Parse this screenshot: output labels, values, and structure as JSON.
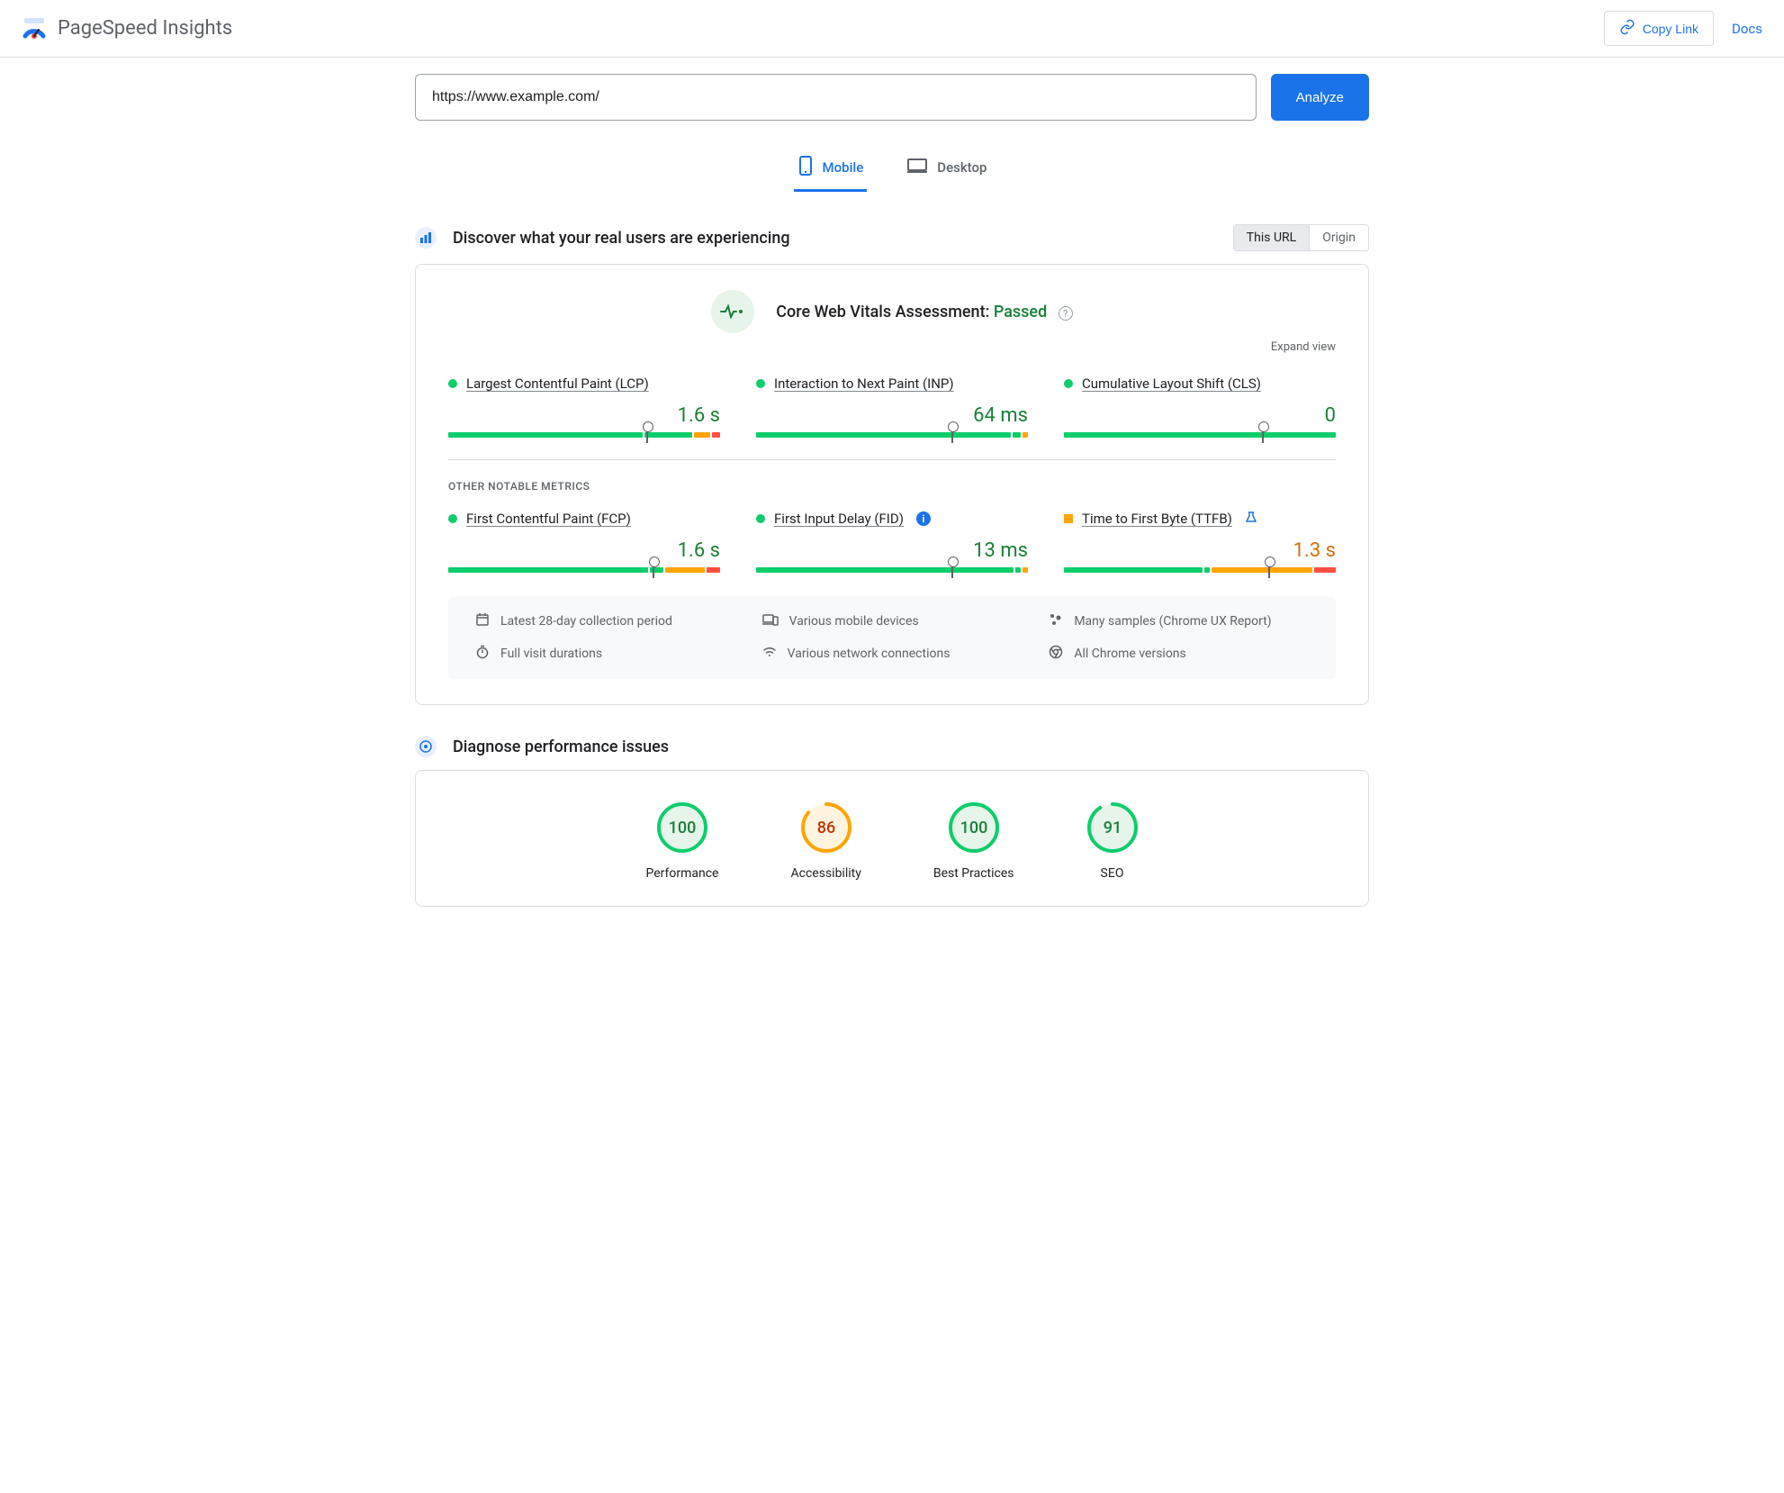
{
  "header": {
    "title": "PageSpeed Insights",
    "copy_link": "Copy Link",
    "docs": "Docs"
  },
  "input": {
    "url": "https://www.example.com/",
    "analyze": "Analyze"
  },
  "tabs": {
    "mobile": "Mobile",
    "desktop": "Desktop",
    "active": "mobile"
  },
  "discover": {
    "title": "Discover what your real users are experiencing",
    "scope": {
      "this_url": "This URL",
      "origin": "Origin",
      "active": "this_url"
    },
    "assessment_label": "Core Web Vitals Assessment:",
    "assessment_status": "Passed",
    "expand": "Expand view",
    "metrics_primary": [
      {
        "name": "Largest Contentful Paint (LCP)",
        "value": "1.6 s",
        "status": "good",
        "marker_pct": 73,
        "segs": [
          73,
          18,
          6,
          3
        ]
      },
      {
        "name": "Interaction to Next Paint (INP)",
        "value": "64 ms",
        "status": "good",
        "marker_pct": 72,
        "segs": [
          95,
          3,
          2,
          0
        ]
      },
      {
        "name": "Cumulative Layout Shift (CLS)",
        "value": "0",
        "status": "good",
        "marker_pct": 73,
        "segs": [
          100,
          0,
          0,
          0
        ]
      }
    ],
    "other_label": "OTHER NOTABLE METRICS",
    "metrics_other": [
      {
        "name": "First Contentful Paint (FCP)",
        "value": "1.6 s",
        "status": "good",
        "marker_pct": 75,
        "segs": [
          75,
          5,
          15,
          5
        ],
        "badge": ""
      },
      {
        "name": "First Input Delay (FID)",
        "value": "13 ms",
        "status": "good",
        "marker_pct": 72,
        "segs": [
          96,
          2,
          2,
          0
        ],
        "badge": "info"
      },
      {
        "name": "Time to First Byte (TTFB)",
        "value": "1.3 s",
        "status": "warn",
        "marker_pct": 75,
        "segs": [
          52,
          2,
          38,
          8
        ],
        "badge": "flask"
      }
    ],
    "meta": {
      "period": "Latest 28-day collection period",
      "devices": "Various mobile devices",
      "samples_prefix": "Many samples (",
      "samples_link": "Chrome UX Report",
      "samples_suffix": ")",
      "durations": "Full visit durations",
      "network": "Various network connections",
      "chrome": "All Chrome versions"
    }
  },
  "diagnose": {
    "title": "Diagnose performance issues",
    "gauges": [
      {
        "label": "Performance",
        "score": 100,
        "color": "#0cce6b",
        "bg": "#e6f4ea"
      },
      {
        "label": "Accessibility",
        "score": 86,
        "color": "#ffa400",
        "bg": "#fff4e0"
      },
      {
        "label": "Best Practices",
        "score": 100,
        "color": "#0cce6b",
        "bg": "#e6f4ea"
      },
      {
        "label": "SEO",
        "score": 91,
        "color": "#0cce6b",
        "bg": "#e6f4ea"
      }
    ]
  },
  "colors": {
    "blue": "#1a73e8",
    "green": "#0cce6b",
    "orange": "#ffa400",
    "red": "#ff4e42"
  }
}
